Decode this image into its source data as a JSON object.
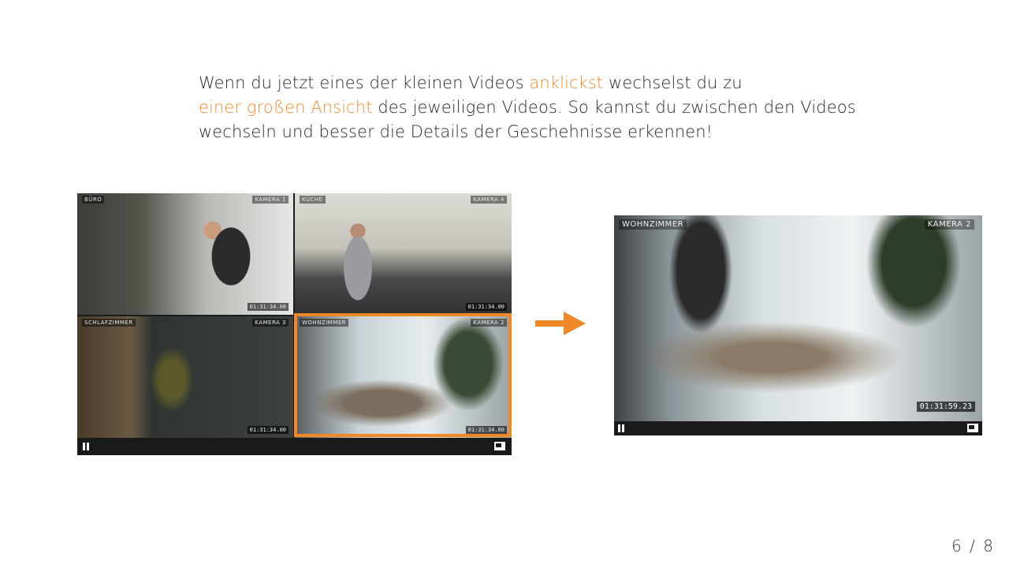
{
  "intro": {
    "part1": "Wenn du jetzt eines der kleinen Videos ",
    "highlight1": "anklickst",
    "part2": " wechselst du zu ",
    "highlight2": "einer großen Ansicht",
    "part3": " des jeweiligen Videos. So kannst du zwischen den Videos wechseln und besser die Details der Geschehnisse erkennen!"
  },
  "grid": {
    "tiles": [
      {
        "left_label": "BÜRO",
        "right_label": "KAMERA 1",
        "timestamp": "01:31:34.00"
      },
      {
        "left_label": "KÜCHE",
        "right_label": "KAMERA 4",
        "timestamp": "01:31:34.00"
      },
      {
        "left_label": "SCHLAFZIMMER",
        "right_label": "KAMERA 3",
        "timestamp": "01:31:34.00"
      },
      {
        "left_label": "WOHNZIMMER",
        "right_label": "KAMERA 2",
        "timestamp": "01:31:34.00"
      }
    ]
  },
  "single": {
    "left_label": "WOHNZIMMER",
    "right_label": "KAMERA 2",
    "timestamp": "01:31:59.23"
  },
  "page_number": "6 / 8",
  "colors": {
    "accent": "#f0882a"
  },
  "icons": {
    "pause": "pause-icon",
    "pip": "pip-icon",
    "arrow": "arrow-right-icon"
  }
}
